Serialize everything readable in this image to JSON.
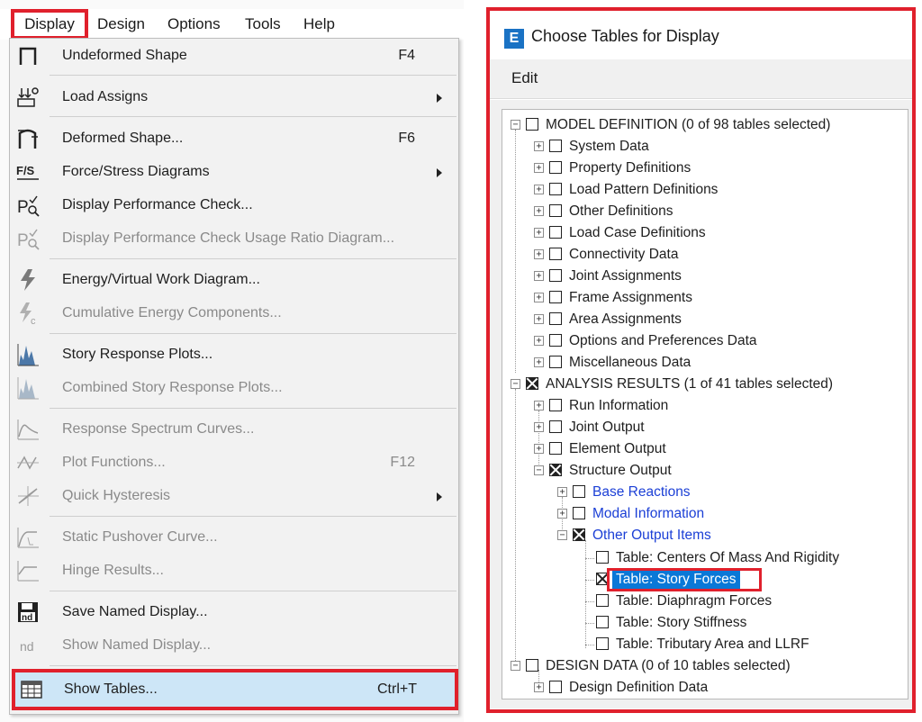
{
  "menubar": {
    "items": [
      "Display",
      "Design",
      "Options",
      "Tools",
      "Help"
    ]
  },
  "display_menu": {
    "items": [
      {
        "label": "Undeformed Shape",
        "shortcut": "F4",
        "icon": "undeformed-shape-icon",
        "enabled": true,
        "submenu": false
      },
      {
        "label": "Load Assigns",
        "shortcut": "",
        "icon": "load-assigns-icon",
        "enabled": true,
        "submenu": true
      },
      {
        "label": "Deformed Shape...",
        "shortcut": "F6",
        "icon": "deformed-shape-icon",
        "enabled": true,
        "submenu": false
      },
      {
        "label": "Force/Stress Diagrams",
        "shortcut": "",
        "icon": "force-stress-icon",
        "enabled": true,
        "submenu": true
      },
      {
        "label": "Display Performance Check...",
        "shortcut": "",
        "icon": "performance-check-icon",
        "enabled": true,
        "submenu": false
      },
      {
        "label": "Display Performance Check Usage Ratio Diagram...",
        "shortcut": "",
        "icon": "usage-ratio-icon",
        "enabled": false,
        "submenu": false
      },
      {
        "label": "Energy/Virtual Work Diagram...",
        "shortcut": "",
        "icon": "energy-icon",
        "enabled": true,
        "submenu": false
      },
      {
        "label": "Cumulative Energy Components...",
        "shortcut": "",
        "icon": "cumulative-energy-icon",
        "enabled": false,
        "submenu": false
      },
      {
        "label": "Story Response Plots...",
        "shortcut": "",
        "icon": "story-response-icon",
        "enabled": true,
        "submenu": false
      },
      {
        "label": "Combined Story Response Plots...",
        "shortcut": "",
        "icon": "combined-story-response-icon",
        "enabled": false,
        "submenu": false
      },
      {
        "label": "Response Spectrum Curves...",
        "shortcut": "",
        "icon": "response-spectrum-icon",
        "enabled": false,
        "submenu": false
      },
      {
        "label": "Plot Functions...",
        "shortcut": "F12",
        "icon": "plot-functions-icon",
        "enabled": false,
        "submenu": false
      },
      {
        "label": "Quick Hysteresis",
        "shortcut": "",
        "icon": "hysteresis-icon",
        "enabled": false,
        "submenu": true
      },
      {
        "label": "Static Pushover Curve...",
        "shortcut": "",
        "icon": "pushover-curve-icon",
        "enabled": false,
        "submenu": false
      },
      {
        "label": "Hinge Results...",
        "shortcut": "",
        "icon": "hinge-results-icon",
        "enabled": false,
        "submenu": false
      },
      {
        "label": "Save Named Display...",
        "shortcut": "",
        "icon": "save-display-icon",
        "enabled": true,
        "submenu": false
      },
      {
        "label": "Show Named Display...",
        "shortcut": "",
        "icon": "named-display-icon",
        "enabled": false,
        "submenu": false
      },
      {
        "label": "Show Tables...",
        "shortcut": "Ctrl+T",
        "icon": "table-icon",
        "enabled": true,
        "submenu": false,
        "highlighted": true
      }
    ],
    "icon_glyphs": {
      "nd": "nd",
      "save_nd": "nd",
      "fs": "F/S",
      "p": "P"
    }
  },
  "dialog": {
    "app_icon": "E",
    "title": "Choose Tables for Display",
    "menu_edit": "Edit",
    "tree": {
      "model_definition": {
        "label": "MODEL DEFINITION  (0 of 98 tables selected)",
        "checked": false
      },
      "model_children": [
        "System Data",
        "Property Definitions",
        "Load Pattern Definitions",
        "Other Definitions",
        "Load Case Definitions",
        "Connectivity Data",
        "Joint Assignments",
        "Frame Assignments",
        "Area Assignments",
        "Options and Preferences Data",
        "Miscellaneous Data"
      ],
      "analysis_results": {
        "label": "ANALYSIS RESULTS  (1 of 41 tables selected)",
        "checked": true
      },
      "analysis_children": [
        "Run Information",
        "Joint Output",
        "Element Output"
      ],
      "structure_output": {
        "label": "Structure Output",
        "checked": true
      },
      "structure_children": [
        "Base Reactions",
        "Modal Information"
      ],
      "other_output_items": {
        "label": "Other Output Items",
        "checked": true
      },
      "tables": [
        {
          "label": "Table:  Centers Of Mass And Rigidity",
          "checked": false,
          "selected": false
        },
        {
          "label": "Table:  Story Forces",
          "checked": true,
          "selected": true
        },
        {
          "label": "Table:  Diaphragm Forces",
          "checked": false,
          "selected": false
        },
        {
          "label": "Table:  Story Stiffness",
          "checked": false,
          "selected": false
        },
        {
          "label": "Table:  Tributary Area and LLRF",
          "checked": false,
          "selected": false
        }
      ],
      "design_data": {
        "label": "DESIGN DATA  (0 of 10 tables selected)",
        "checked": false
      },
      "design_children": [
        "Design Definition Data"
      ]
    }
  },
  "colors": {
    "highlight_border": "#e0202c",
    "menu_hover": "#cde6f7",
    "tree_selection": "#0a78d7",
    "tree_link": "#1b3fd6",
    "app_icon": "#1a72c4"
  }
}
